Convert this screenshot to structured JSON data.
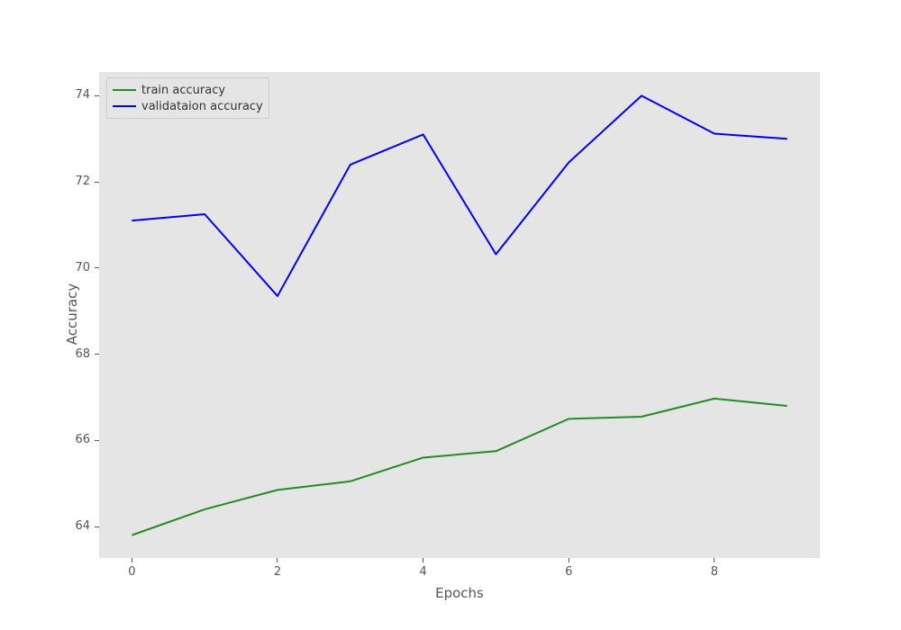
{
  "chart_data": {
    "type": "line",
    "xlabel": "Epochs",
    "ylabel": "Accuracy",
    "title": "",
    "xlim": [
      -0.45,
      9.45
    ],
    "ylim": [
      63.27,
      74.55
    ],
    "xticks": [
      0,
      2,
      4,
      6,
      8
    ],
    "yticks": [
      64,
      66,
      68,
      70,
      72,
      74
    ],
    "x": [
      0,
      1,
      2,
      3,
      4,
      5,
      6,
      7,
      8,
      9
    ],
    "series": [
      {
        "name": "train accuracy",
        "color": "#228b22",
        "values": [
          63.8,
          64.4,
          64.85,
          65.05,
          65.6,
          65.75,
          66.5,
          66.55,
          66.97,
          66.8
        ]
      },
      {
        "name": "validataion accuracy",
        "color": "#0000ff",
        "values": [
          71.1,
          71.25,
          69.35,
          72.4,
          73.1,
          70.32,
          72.45,
          74.0,
          73.12,
          73.0
        ]
      }
    ],
    "legend_loc": "upper-left"
  }
}
